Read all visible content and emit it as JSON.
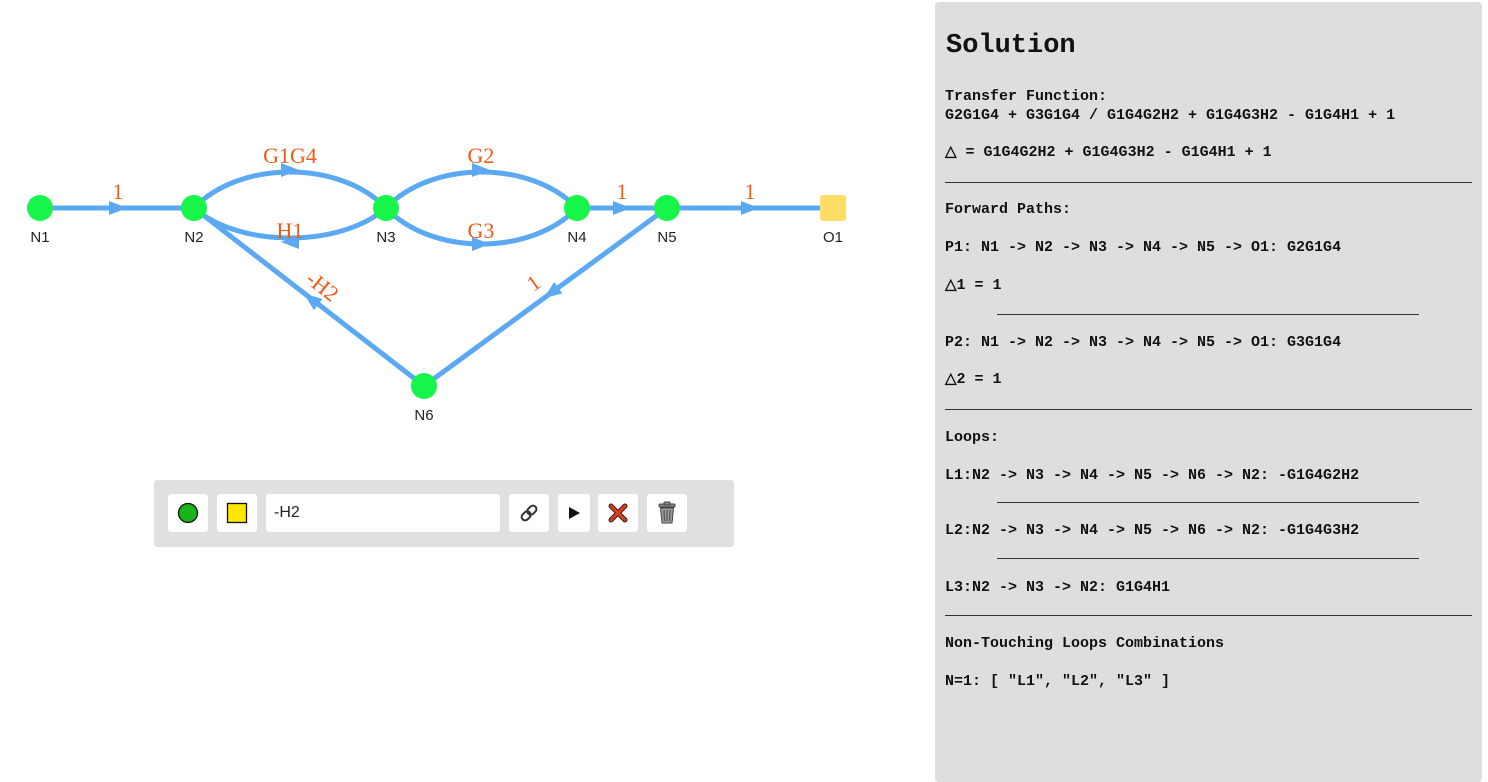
{
  "graph": {
    "nodes": [
      {
        "id": "N1",
        "label": "N1",
        "kind": "node"
      },
      {
        "id": "N2",
        "label": "N2",
        "kind": "node"
      },
      {
        "id": "N3",
        "label": "N3",
        "kind": "node"
      },
      {
        "id": "N4",
        "label": "N4",
        "kind": "node"
      },
      {
        "id": "N5",
        "label": "N5",
        "kind": "node"
      },
      {
        "id": "N6",
        "label": "N6",
        "kind": "node"
      },
      {
        "id": "O1",
        "label": "O1",
        "kind": "output"
      }
    ],
    "edges": [
      {
        "from": "N1",
        "to": "N2",
        "gain": "1"
      },
      {
        "from": "N2",
        "to": "N3",
        "gain": "G1G4"
      },
      {
        "from": "N3",
        "to": "N2",
        "gain": "H1"
      },
      {
        "from": "N3",
        "to": "N4",
        "gain": "G2"
      },
      {
        "from": "N3",
        "to": "N4",
        "gain": "G3"
      },
      {
        "from": "N4",
        "to": "N5",
        "gain": "1"
      },
      {
        "from": "N5",
        "to": "O1",
        "gain": "1"
      },
      {
        "from": "N6",
        "to": "N2",
        "gain": "-H2"
      },
      {
        "from": "N5",
        "to": "N6",
        "gain": "1"
      }
    ],
    "colors": {
      "edge": "#5aa9f2",
      "node": "#18f54a",
      "output_node": "#ffdd66",
      "gain_text": "#f05a16"
    }
  },
  "toolbar": {
    "add_node_icon": "green-circle-icon",
    "add_output_icon": "yellow-square-icon",
    "gain_value": "-H2",
    "connect_icon": "link-icon",
    "run_icon": "play-icon",
    "delete_icon": "red-x-icon",
    "clear_icon": "trash-can-icon"
  },
  "solution": {
    "title": "Solution",
    "transfer_function_label": "Transfer Function:",
    "transfer_function": "G2G1G4 + G3G1G4 / G1G4G2H2 + G1G4G3H2 - G1G4H1 + 1",
    "delta": "△ = G1G4G2H2 + G1G4G3H2 - G1G4H1 + 1",
    "forward_paths_label": "Forward Paths:",
    "paths": [
      {
        "text": "P1: N1 -> N2 -> N3 -> N4 -> N5 -> O1: G2G1G4",
        "delta": "△1 = 1"
      },
      {
        "text": "P2: N1 -> N2 -> N3 -> N4 -> N5 -> O1: G3G1G4",
        "delta": "△2 = 1"
      }
    ],
    "loops_label": "Loops:",
    "loops": [
      "L1:N2 -> N3 -> N4 -> N5 -> N6 -> N2: -G1G4G2H2",
      "L2:N2 -> N3 -> N4 -> N5 -> N6 -> N2: -G1G4G3H2",
      "L3:N2 -> N3 -> N2: G1G4H1"
    ],
    "non_touching_label": "Non-Touching Loops Combinations",
    "non_touching": "N=1: [ \"L1\", \"L2\", \"L3\" ]"
  }
}
